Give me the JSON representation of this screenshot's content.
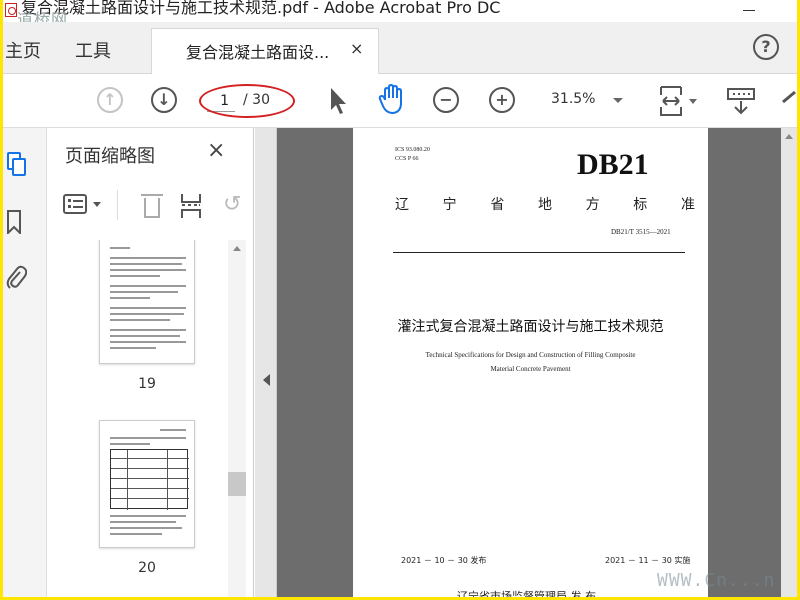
{
  "window": {
    "title": "复合混凝土路面设计与施工技术规范.pdf - Adobe Acrobat Pro DC",
    "corner_watermark": "道桥网"
  },
  "tabs": {
    "home": "主页",
    "tools": "工具",
    "document": "复合混凝土路面设...",
    "close": "×",
    "help": "?"
  },
  "toolbar": {
    "icons": [
      "arrow-up-circle-icon",
      "arrow-down-circle-icon",
      "pointer-icon",
      "hand-icon",
      "zoom-out-icon",
      "zoom-in-icon",
      "page-fit-icon",
      "scroll-mode-icon",
      "sign-icon"
    ],
    "page_current": "1",
    "page_total": "/ 30",
    "zoom": "31.5%",
    "annotation_color": "#d42020"
  },
  "thumbnails": {
    "heading": "页面缩略图",
    "close": "×",
    "pages": [
      {
        "label": "19"
      },
      {
        "label": "20"
      }
    ]
  },
  "document": {
    "ics": "ICS 93.080.20",
    "ccs": "CCS P 66",
    "badge": "DB21",
    "standard_chars": [
      "辽",
      "宁",
      "省",
      "地",
      "方",
      "标",
      "准"
    ],
    "code": "DB21/T 3515—2021",
    "title_cn": "灌注式复合混凝土路面设计与施工技术规范",
    "title_en_line1": "Technical Specifications for Design and Construction of Filling Composite",
    "title_en_line2": "Material Concrete Pavement",
    "issue_date": "2021 － 10 － 30 发布",
    "impl_date": "2021 － 11 － 30 实施",
    "issuer": "辽宁省市场监督管理局   发 布"
  },
  "page_watermark": "WWW.Cn...n"
}
